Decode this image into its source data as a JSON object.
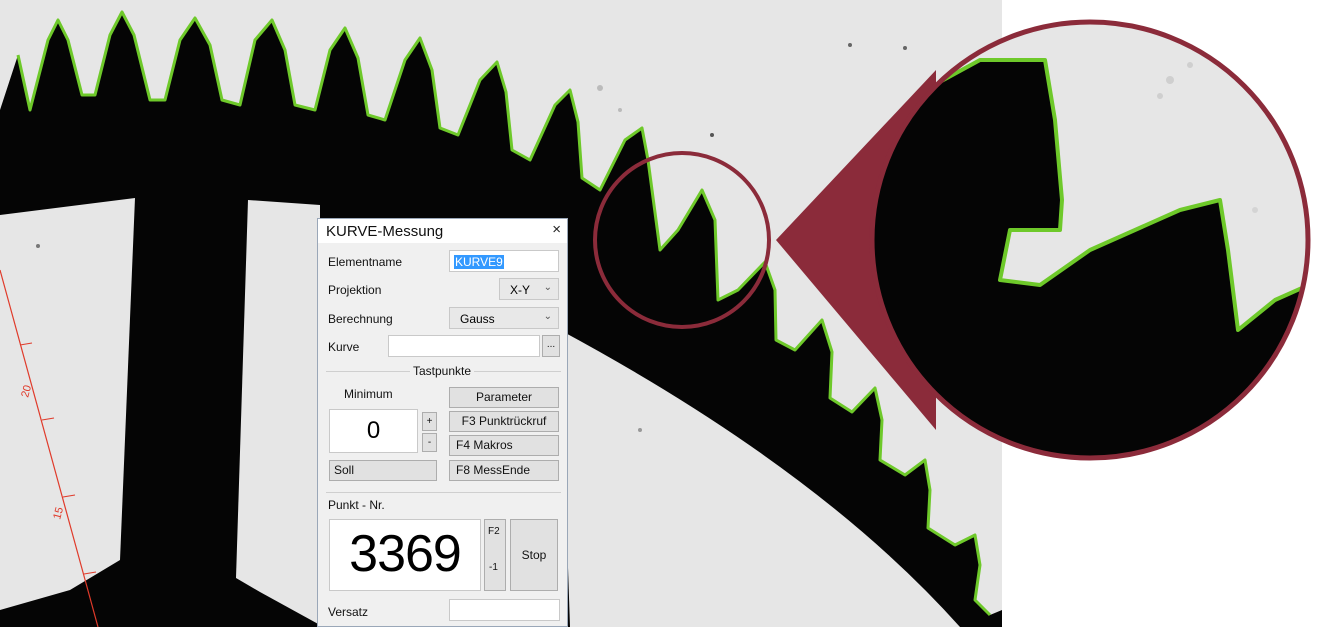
{
  "dialog": {
    "title": "KURVE-Messung",
    "close_label": "×",
    "elementname_label": "Elementname",
    "elementname_value": "KURVE9",
    "projektion_label": "Projektion",
    "projektion_value": "X-Y",
    "berechnung_label": "Berechnung",
    "berechnung_value": "Gauss",
    "kurve_label": "Kurve",
    "kurve_value": "",
    "kurve_browse": "...",
    "tastpunkte_label": "Tastpunkte",
    "minimum_label": "Minimum",
    "minimum_value": "0",
    "plus_label": "+",
    "minus_label": "-",
    "soll_label": "Soll",
    "parameter_label": "Parameter",
    "f3_label": "F3 Punktrückruf",
    "f4_label": "F4  Makros",
    "f8_label": "F8  MessEnde",
    "punkt_nr_label": "Punkt - Nr.",
    "punkt_nr_value": "3369",
    "f2_label": "F2",
    "minus1_label": "-1",
    "stop_label": "Stop",
    "versatz_label": "Versatz",
    "versatz_value": ""
  },
  "ruler_labels": [
    "20",
    "15"
  ],
  "colors": {
    "edge_highlight": "#6ec92a",
    "callout": "#8b2b3a",
    "ruler": "#e03a2a",
    "background": "#e6e6e6",
    "part": "#050505"
  }
}
